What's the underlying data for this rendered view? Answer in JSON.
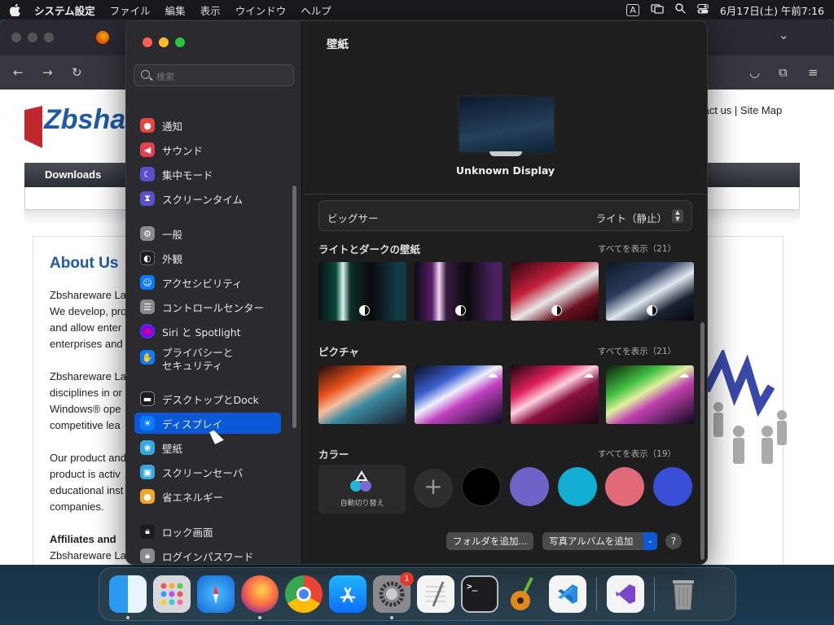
{
  "menubar": {
    "app_name": "システム設定",
    "items": [
      "ファイル",
      "編集",
      "表示",
      "ウインドウ",
      "ヘルプ"
    ],
    "ime": "A",
    "clock": "6月17日(土) 午前7:16"
  },
  "website": {
    "logo_text": "Zbshare",
    "links": "tact us | Site Map",
    "nav_first": "Downloads",
    "heading": "About Us",
    "para1": "Zbshareware La\nWe develop, pro\nand allow enter\nenterprises and",
    "para2": "Zbshareware La\ndisciplines in or\nWindows® ope\ncompetitive lea",
    "para3": "Our product and\nproduct is activ\neducational inst\ncompanies.",
    "affiliates": "Affiliates and",
    "para4": "Zbshareware La"
  },
  "settings": {
    "search_placeholder": "検索",
    "sidebar": [
      {
        "label": "通知",
        "icon": "bell-icon",
        "color": "#e5453a"
      },
      {
        "label": "サウンド",
        "icon": "speaker-icon",
        "color": "#e5404f"
      },
      {
        "label": "集中モード",
        "icon": "moon-icon",
        "color": "#5a4fcf"
      },
      {
        "label": "スクリーンタイム",
        "icon": "hourglass-icon",
        "color": "#5a4fcf"
      },
      {
        "label": "一般",
        "icon": "gear-icon",
        "color": "#8a8a8e"
      },
      {
        "label": "外観",
        "icon": "appearance-icon",
        "color": "#1c1c1e"
      },
      {
        "label": "アクセシビリティ",
        "icon": "accessibility-icon",
        "color": "#0a7aff"
      },
      {
        "label": "コントロールセンター",
        "icon": "toggles-icon",
        "color": "#8a8a8e"
      },
      {
        "label": "Siri と Spotlight",
        "icon": "siri-icon",
        "color": "#7a3cc6"
      },
      {
        "label": "プライバシーと",
        "label2": "セキュリティ",
        "icon": "hand-icon",
        "color": "#0a7aff"
      },
      {
        "label": "デスクトップとDock",
        "icon": "dock-icon",
        "color": "#1c1c1e"
      },
      {
        "label": "ディスプレイ",
        "icon": "sun-icon",
        "color": "#0a7aff"
      },
      {
        "label": "壁紙",
        "icon": "flower-icon",
        "color": "#35a8e0"
      },
      {
        "label": "スクリーンセーバ",
        "icon": "screensaver-icon",
        "color": "#35a8e0"
      },
      {
        "label": "省エネルギー",
        "icon": "lightbulb-icon",
        "color": "#f5a623"
      },
      {
        "label": "ロック画面",
        "icon": "lock-icon",
        "color": "#1c1c1e"
      },
      {
        "label": "ログインパスワード",
        "icon": "password-icon",
        "color": "#8a8a8e"
      }
    ],
    "selected": "ディスプレイ",
    "title": "壁紙",
    "display_name": "Unknown Display",
    "wallpaper_name": "ビッグサー",
    "wallpaper_mode": "ライト（静止）",
    "section_light_dark": "ライトとダークの壁紙",
    "section_light_dark_all": "すべてを表示（21）",
    "section_pictures": "ピクチャ",
    "section_pictures_all": "すべてを表示（21）",
    "section_colors": "カラー",
    "section_colors_all": "すべてを表示（19）",
    "auto_rotate": "自動切り替え",
    "colors": [
      "#000000",
      "#6e64c8",
      "#12aed4",
      "#e06a78",
      "#3a4fd8"
    ],
    "add_folder": "フォルダを追加...",
    "add_album": "写真アルバムを追加",
    "help": "?"
  },
  "dock": {
    "apps": [
      "finder-icon",
      "launchpad-icon",
      "safari-icon",
      "firefox-icon",
      "chrome-icon",
      "app-store-icon",
      "system-settings-icon",
      "textedit-icon",
      "terminal-icon",
      "garageband-icon",
      "vscode-icon",
      "visual-studio-icon",
      "trash-icon"
    ],
    "settings_badge": "1",
    "terminal_glyph": ">_"
  }
}
